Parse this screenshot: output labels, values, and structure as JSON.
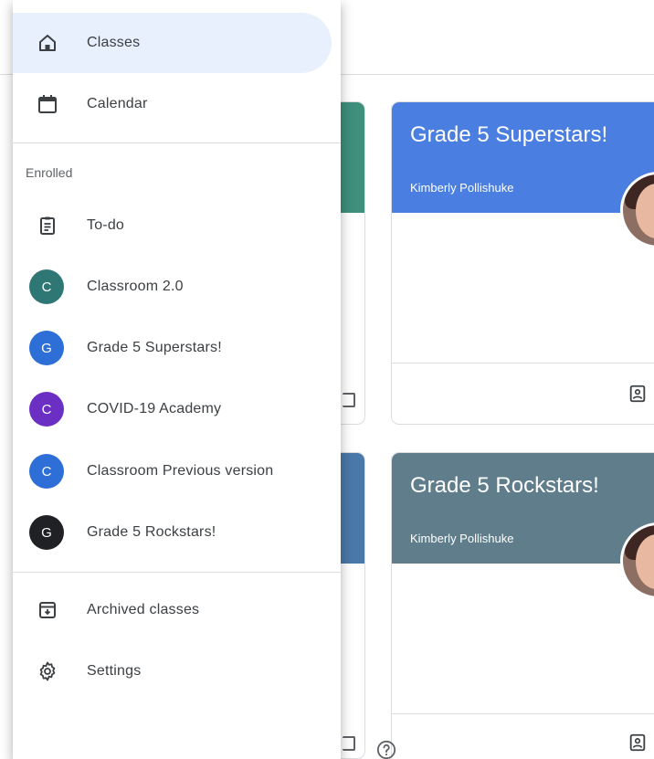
{
  "drawer": {
    "main_items": [
      {
        "label": "Classes",
        "icon": "home-icon",
        "active": true
      },
      {
        "label": "Calendar",
        "icon": "calendar-icon",
        "active": false
      }
    ],
    "section_label": "Enrolled",
    "todo": {
      "label": "To-do",
      "icon": "clipboard-icon"
    },
    "classes": [
      {
        "initial": "C",
        "label": "Classroom 2.0",
        "color": "#2f7774"
      },
      {
        "initial": "G",
        "label": "Grade 5 Superstars!",
        "color": "#2d6fd6"
      },
      {
        "initial": "C",
        "label": "COVID-19 Academy",
        "color": "#6b2fc4"
      },
      {
        "initial": "C",
        "label": "Classroom Previous version",
        "color": "#2d6fd6"
      },
      {
        "initial": "G",
        "label": "Grade 5 Rockstars!",
        "color": "#202124"
      }
    ],
    "bottom_items": [
      {
        "label": "Archived classes",
        "icon": "archive-icon"
      },
      {
        "label": "Settings",
        "icon": "gear-icon"
      }
    ]
  },
  "cards": [
    {
      "title": "Grade 5 Superstars!",
      "teacher": "Kimberly Pollishuke",
      "color": "#4a7ee0"
    },
    {
      "title": "Grade 5 Rockstars!",
      "teacher": "Kimberly Pollishuke",
      "color": "#607d8b"
    }
  ]
}
